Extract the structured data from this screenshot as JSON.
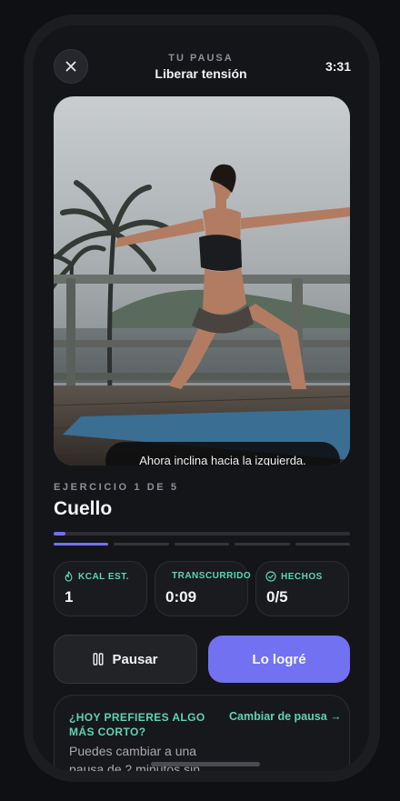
{
  "header": {
    "kicker": "TU PAUSA",
    "title": "Liberar tensión",
    "timer": "3:31"
  },
  "video": {
    "caption": "Ahora inclina hacia la izquierda."
  },
  "exercise": {
    "kicker": "EJERCICIO 1 DE 5",
    "title": "Cuello",
    "progress": 0.04,
    "current_step": 1,
    "total_steps": 5
  },
  "stats": [
    {
      "label": "KCAL EST.",
      "value": "1",
      "icon": "flame-icon"
    },
    {
      "label": "TRANSCURRIDO",
      "value": "0:09",
      "icon": "none"
    },
    {
      "label": "HECHOS",
      "value": "0/5",
      "icon": "check-circle-icon"
    }
  ],
  "actions": {
    "pause_label": "Pausar",
    "done_label": "Lo logré"
  },
  "suggestion": {
    "title": "¿HOY PREFIERES ALGO MÁS CORTO?",
    "link": "Cambiar de pausa →",
    "body": "Puedes cambiar a una pausa de 2 minutos sin"
  },
  "colors": {
    "accent": "#7271f2",
    "teal": "#5fd4b4",
    "background": "#141518"
  }
}
